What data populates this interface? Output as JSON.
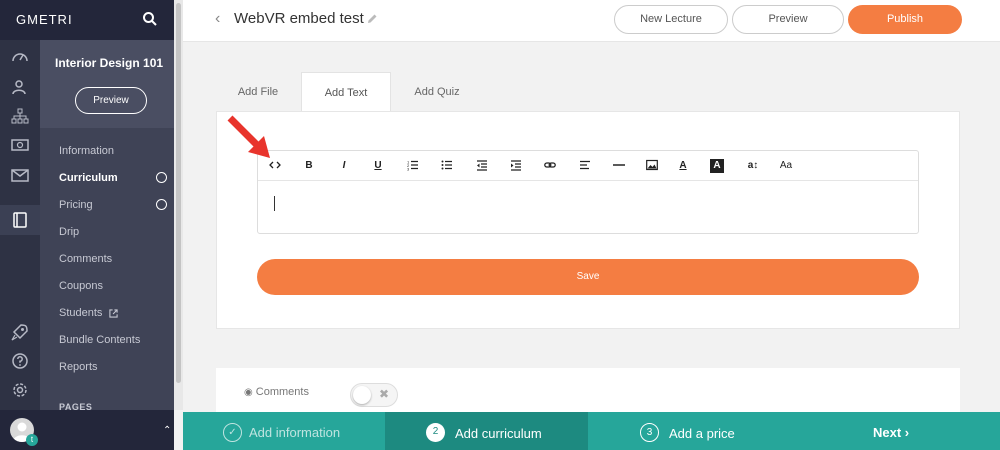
{
  "brand": {
    "name": "GMETRI"
  },
  "header": {
    "lecture_title": "WebVR embed test",
    "new_lecture_label": "New Lecture",
    "preview_label": "Preview",
    "publish_label": "Publish"
  },
  "course": {
    "title": "Interior Design 101",
    "preview_label": "Preview",
    "nav": [
      {
        "label": "Information"
      },
      {
        "label": "Curriculum"
      },
      {
        "label": "Pricing"
      },
      {
        "label": "Drip"
      },
      {
        "label": "Comments"
      },
      {
        "label": "Coupons"
      },
      {
        "label": "Students"
      },
      {
        "label": "Bundle Contents"
      },
      {
        "label": "Reports"
      }
    ],
    "pages_label": "PAGES"
  },
  "tabs": [
    {
      "label": "Add File"
    },
    {
      "label": "Add Text"
    },
    {
      "label": "Add Quiz"
    }
  ],
  "editor": {
    "toolbar": {
      "bold": "B",
      "italic": "I",
      "underline": "U",
      "font_size": "a↕",
      "font": "Aa",
      "text_color": "A",
      "bg_color": "A"
    },
    "save_label": "Save"
  },
  "comments": {
    "label": "Comments",
    "enabled": false
  },
  "stepper": [
    {
      "number": "",
      "label": "Add information"
    },
    {
      "number": "2",
      "label": "Add curriculum"
    },
    {
      "number": "3",
      "label": "Add a price"
    }
  ],
  "next_label": "Next ›",
  "colors": {
    "accent": "#f47d42",
    "sidebar_dark": "#2e3244",
    "sidebar_panel": "#3f4356",
    "stepper": "#26a69a",
    "stepper_active": "#1d8a80"
  }
}
